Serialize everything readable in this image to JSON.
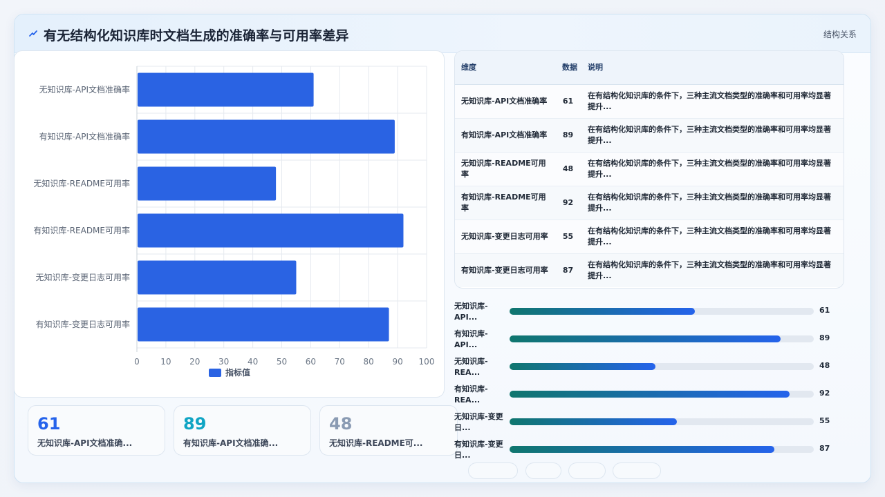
{
  "header": {
    "title": "有无结构化知识库时文档生成的准确率与可用率差异",
    "tag": "结构关系",
    "logo_icon": "lightning-icon"
  },
  "chart_data": {
    "type": "bar",
    "orientation": "horizontal",
    "categories": [
      "无知识库-API文档准确率",
      "有知识库-API文档准确率",
      "无知识库-README可用率",
      "有知识库-README可用率",
      "无知识库-变更日志可用率",
      "有知识库-变更日志可用率"
    ],
    "series": [
      {
        "name": "指标值",
        "values": [
          61,
          89,
          48,
          92,
          55,
          87
        ]
      }
    ],
    "xlim": [
      0,
      100
    ],
    "xticks": [
      0,
      10,
      20,
      30,
      40,
      50,
      60,
      70,
      80,
      90,
      100
    ],
    "grid": true,
    "legend_position": "bottom",
    "color": "#2a63e3"
  },
  "kpis": [
    {
      "value": "61",
      "label": "无知识库-API文档准确...",
      "color": "#2563eb"
    },
    {
      "value": "89",
      "label": "有知识库-API文档准确...",
      "color": "#10a5c4"
    },
    {
      "value": "48",
      "label": "无知识库-README可...",
      "color": "#8a9bb3"
    }
  ],
  "table": {
    "headers": [
      "维度",
      "数据",
      "说明"
    ],
    "rows": [
      {
        "dim": "无知识库-API文档准确率",
        "val": "61",
        "desc": "在有结构化知识库的条件下，三种主流文档类型的准确率和可用率均显著提升..."
      },
      {
        "dim": "有知识库-API文档准确率",
        "val": "89",
        "desc": "在有结构化知识库的条件下，三种主流文档类型的准确率和可用率均显著提升..."
      },
      {
        "dim": "无知识库-README可用率",
        "val": "48",
        "desc": "在有结构化知识库的条件下，三种主流文档类型的准确率和可用率均显著提升..."
      },
      {
        "dim": "有知识库-README可用率",
        "val": "92",
        "desc": "在有结构化知识库的条件下，三种主流文档类型的准确率和可用率均显著提升..."
      },
      {
        "dim": "无知识库-变更日志可用率",
        "val": "55",
        "desc": "在有结构化知识库的条件下，三种主流文档类型的准确率和可用率均显著提升..."
      },
      {
        "dim": "有知识库-变更日志可用率",
        "val": "87",
        "desc": "在有结构化知识库的条件下，三种主流文档类型的准确率和可用率均显著提升..."
      }
    ]
  },
  "progress": [
    {
      "label": "无知识库-API...",
      "value": 61
    },
    {
      "label": "有知识库-API...",
      "value": 89
    },
    {
      "label": "无知识库-REA...",
      "value": 48
    },
    {
      "label": "有知识库-REA...",
      "value": 92
    },
    {
      "label": "无知识库-变更日...",
      "value": 55
    },
    {
      "label": "有知识库-变更日...",
      "value": 87
    }
  ]
}
